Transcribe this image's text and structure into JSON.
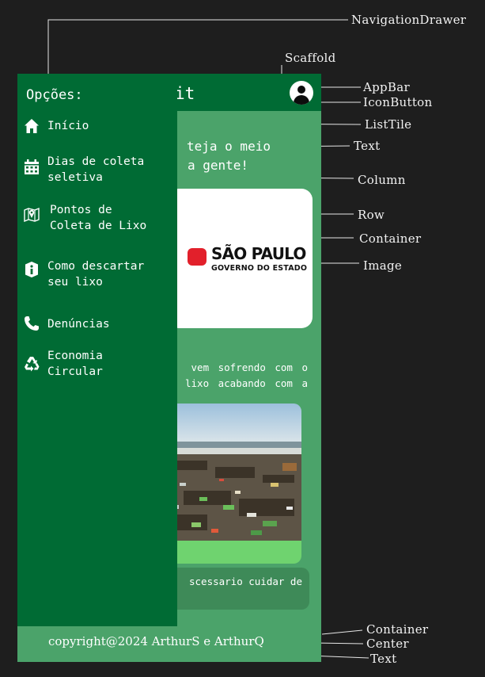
{
  "annotations": [
    {
      "id": "navigationdrawer",
      "text": "NavigationDrawer"
    },
    {
      "id": "scaffold",
      "text": "Scaffold"
    },
    {
      "id": "appbar",
      "text": "AppBar"
    },
    {
      "id": "iconbutton",
      "text": "IconButton"
    },
    {
      "id": "listtile",
      "text": "ListTile"
    },
    {
      "id": "text",
      "text": "Text"
    },
    {
      "id": "column",
      "text": "Column"
    },
    {
      "id": "row",
      "text": "Row"
    },
    {
      "id": "container",
      "text": "Container"
    },
    {
      "id": "image",
      "text": "Image"
    },
    {
      "id": "container-footer",
      "text": "Container"
    },
    {
      "id": "center",
      "text": "Center"
    },
    {
      "id": "text-footer",
      "text": "Text"
    }
  ],
  "appbar": {
    "title_fragment": "it",
    "user_icon": "account-circle-icon"
  },
  "main": {
    "headline": {
      "line1": "teja o meio",
      "line2": "a gente!"
    },
    "logo": {
      "name": "SÃO PAULO",
      "subtitle": "GOVERNO DO ESTADO",
      "mark_color": "#e2202b"
    },
    "paragraph": {
      "line1": "vem sofrendo com o",
      "line2": "lixo acabando com a"
    },
    "photo": {
      "subject": "beach-trash-photo"
    },
    "bottom_text": "scessario cuidar de"
  },
  "drawer": {
    "header": "Opções:",
    "items": [
      {
        "label1": "Início",
        "label2": "",
        "icon": "home-icon"
      },
      {
        "label1": "Dias de coleta",
        "label2": "seletiva",
        "icon": "calendar-icon"
      },
      {
        "label1": "Pontos de",
        "label2": "Coleta de Lixo",
        "icon": "map-pin-icon"
      },
      {
        "label1": "Como descartar",
        "label2": "seu lixo",
        "icon": "info-icon"
      },
      {
        "label1": "Denúncias",
        "label2": "",
        "icon": "phone-icon"
      },
      {
        "label1": "Economia",
        "label2": "Circular",
        "icon": "recycle-icon"
      }
    ]
  },
  "footer": {
    "text": "copyright@2024 ArthurS e ArthurQ"
  },
  "colors": {
    "background": "#1e1e1e",
    "appbar": "#006b34",
    "drawer": "#006b34",
    "body": "#4ba36a",
    "photo_card_accent": "#6fd36f",
    "annotation_line": "#e6e6e6"
  }
}
